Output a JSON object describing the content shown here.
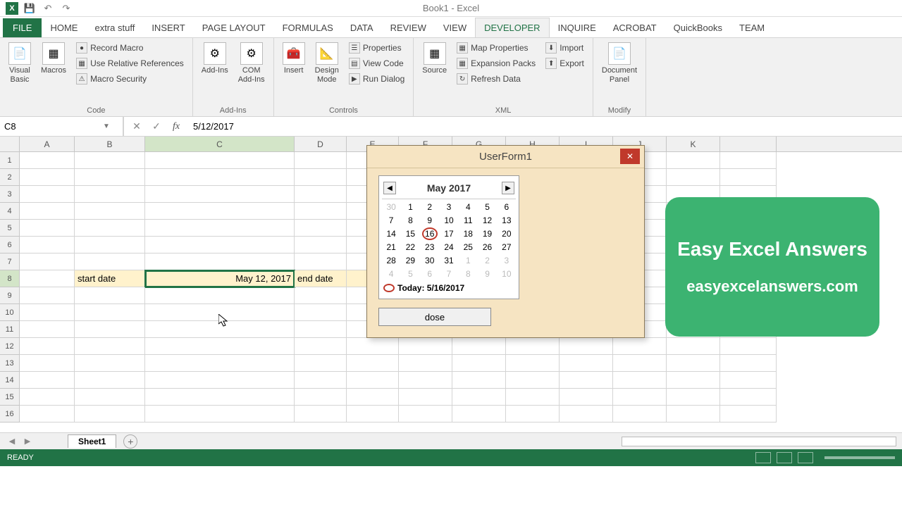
{
  "app": {
    "title": "Book1 - Excel"
  },
  "qat": {
    "save": "💾",
    "undo": "↶",
    "redo": "↷"
  },
  "tabs": [
    "FILE",
    "HOME",
    "extra stuff",
    "INSERT",
    "PAGE LAYOUT",
    "FORMULAS",
    "DATA",
    "REVIEW",
    "VIEW",
    "DEVELOPER",
    "INQUIRE",
    "ACROBAT",
    "QuickBooks",
    "TEAM"
  ],
  "active_tab": "DEVELOPER",
  "ribbon": {
    "code": {
      "visual_basic": "Visual\nBasic",
      "macros": "Macros",
      "record": "Record Macro",
      "relative": "Use Relative References",
      "security": "Macro Security",
      "group": "Code"
    },
    "addins": {
      "addins": "Add-Ins",
      "com": "COM\nAdd-Ins",
      "group": "Add-Ins"
    },
    "controls": {
      "insert": "Insert",
      "design": "Design\nMode",
      "properties": "Properties",
      "viewcode": "View Code",
      "rundialog": "Run Dialog",
      "group": "Controls"
    },
    "xml": {
      "source": "Source",
      "map": "Map Properties",
      "expansion": "Expansion Packs",
      "refresh": "Refresh Data",
      "import": "Import",
      "export": "Export",
      "group": "XML"
    },
    "modify": {
      "docpanel": "Document\nPanel",
      "group": "Modify"
    }
  },
  "formula": {
    "namebox": "C8",
    "value": "5/12/2017"
  },
  "columns": [
    "A",
    "B",
    "C",
    "D",
    "E",
    "F",
    "G",
    "H",
    "I",
    "J",
    "K"
  ],
  "rows": [
    1,
    2,
    3,
    4,
    5,
    6,
    7,
    8,
    9,
    10,
    11,
    12,
    13,
    14,
    15,
    16
  ],
  "cells": {
    "B8": "start date",
    "C8": "May 12, 2017",
    "D8": "end date"
  },
  "userform": {
    "title": "UserForm1",
    "month": "May 2017",
    "today_label": "Today: 5/16/2017",
    "close_btn": "dose",
    "days": [
      {
        "n": "30",
        "g": true
      },
      {
        "n": "1"
      },
      {
        "n": "2"
      },
      {
        "n": "3"
      },
      {
        "n": "4"
      },
      {
        "n": "5"
      },
      {
        "n": "6"
      },
      {
        "n": "7"
      },
      {
        "n": "8"
      },
      {
        "n": "9"
      },
      {
        "n": "10"
      },
      {
        "n": "11"
      },
      {
        "n": "12"
      },
      {
        "n": "13"
      },
      {
        "n": "14"
      },
      {
        "n": "15"
      },
      {
        "n": "16",
        "today": true
      },
      {
        "n": "17"
      },
      {
        "n": "18"
      },
      {
        "n": "19"
      },
      {
        "n": "20"
      },
      {
        "n": "21"
      },
      {
        "n": "22"
      },
      {
        "n": "23"
      },
      {
        "n": "24"
      },
      {
        "n": "25"
      },
      {
        "n": "26"
      },
      {
        "n": "27"
      },
      {
        "n": "28"
      },
      {
        "n": "29"
      },
      {
        "n": "30"
      },
      {
        "n": "31"
      },
      {
        "n": "1",
        "g": true
      },
      {
        "n": "2",
        "g": true
      },
      {
        "n": "3",
        "g": true
      },
      {
        "n": "4",
        "g": true
      },
      {
        "n": "5",
        "g": true
      },
      {
        "n": "6",
        "g": true
      },
      {
        "n": "7",
        "g": true
      },
      {
        "n": "8",
        "g": true
      },
      {
        "n": "9",
        "g": true
      },
      {
        "n": "10",
        "g": true
      }
    ]
  },
  "overlay": {
    "line1": "Easy Excel Answers",
    "line2": "easyexcelanswers.com"
  },
  "sheet": {
    "name": "Sheet1"
  },
  "status": {
    "ready": "READY"
  }
}
